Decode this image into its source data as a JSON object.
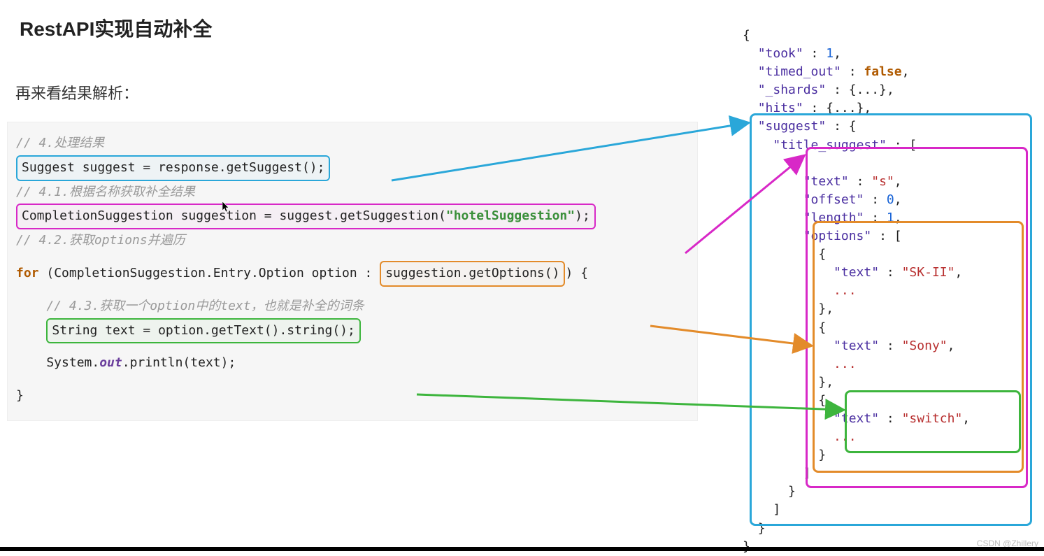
{
  "title": "RestAPI实现自动补全",
  "subtitle": "再来看结果解析：",
  "code": {
    "c1": "// 4.处理结果",
    "l1": "Suggest suggest = response.getSuggest();",
    "c2": "// 4.1.根据名称获取补全结果",
    "l2_pre": "CompletionSuggestion suggestion = suggest.getSuggestion(",
    "l2_str": "\"hotelSuggestion\"",
    "l2_post": ");",
    "c3": "// 4.2.获取options并遍历",
    "l3_kw": "for",
    "l3_mid": " (CompletionSuggestion.Entry.Option option : ",
    "l3_box": "suggestion.getOptions()",
    "l3_tail": ") {",
    "c4": "    // 4.3.获取一个option中的text，也就是补全的词条",
    "l4": "String text = option.getText().string();",
    "l5a": "    System.",
    "l5b": "out",
    "l5c": ".println(text);",
    "l6": "}"
  },
  "json": {
    "open": "{",
    "took_k": "\"took\"",
    "took_v": "1",
    "timed_k": "\"timed_out\"",
    "timed_v": "false",
    "shards_k": "\"_shards\"",
    "shards_v": "{...}",
    "hits_k": "\"hits\"",
    "hits_v": "{...}",
    "suggest_k": "\"suggest\"",
    "title_sugg_k": "\"title_suggest\"",
    "text_k": "\"text\"",
    "text_v": "\"s\"",
    "offset_k": "\"offset\"",
    "offset_v": "0",
    "length_k": "\"length\"",
    "length_v": "1",
    "options_k": "\"options\"",
    "opt1_text_k": "\"text\"",
    "opt1_text_v": "\"SK-II\"",
    "opt2_text_k": "\"text\"",
    "opt2_text_v": "\"Sony\"",
    "opt3_text_k": "\"text\"",
    "opt3_text_v": "\"switch\"",
    "ellipsis": "...",
    "close": "}"
  },
  "watermark": "CSDN @Zhillery"
}
